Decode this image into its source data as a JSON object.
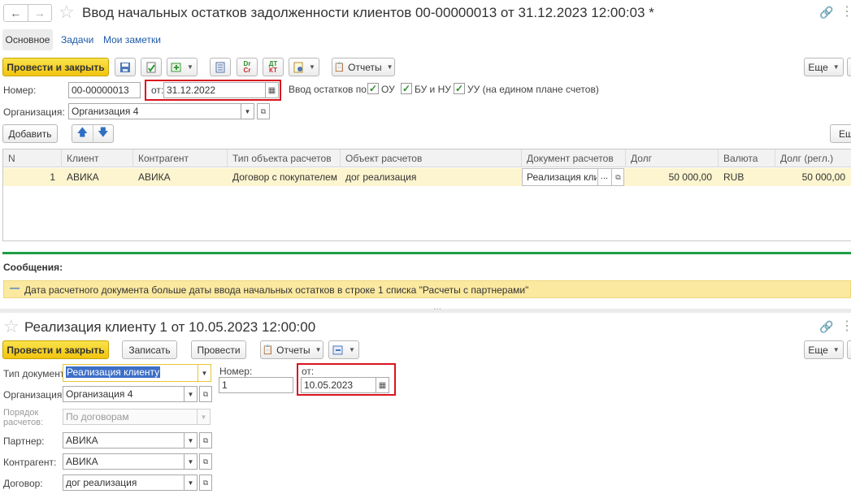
{
  "doc1": {
    "title": "Ввод начальных остатков задолженности клиентов 00-00000013 от 31.12.2023 12:00:03 *",
    "tabs": [
      "Основное",
      "Задачи",
      "Мои заметки"
    ],
    "toolbar": {
      "post_close": "Провести и закрыть",
      "reports": "Отчеты",
      "more": "Еще",
      "help": "?",
      "dt_kt_top": "Dr",
      "dt_kt_bottom": "Cr",
      "dt_top": "ДТ",
      "dt_bottom": "КТ"
    },
    "number_label": "Номер:",
    "number_value": "00-00000013",
    "date_label": "от:",
    "date_value": "31.12.2022",
    "entry_label": "Ввод остатков по:",
    "checks": [
      "ОУ",
      "БУ и НУ",
      "УУ (на едином плане счетов)"
    ],
    "org_label": "Организация:",
    "org_value": "Организация 4",
    "add_button": "Добавить",
    "more_short": "Еш",
    "table": {
      "headers": [
        "N",
        "Клиент",
        "Контрагент",
        "Тип объекта расчетов",
        "Объект расчетов",
        "Документ расчетов",
        "Долг",
        "Валюта",
        "Долг (регл.)"
      ],
      "row": {
        "n": "1",
        "client": "АВИКА",
        "contractor": "АВИКА",
        "type": "Договор с покупателем",
        "object": "дог реализация",
        "document": "Реализация клие",
        "dots": "...",
        "debt": "50 000,00",
        "currency": "RUB",
        "debt_regl": "50 000,00"
      }
    },
    "messages_title": "Сообщения:",
    "message_text": "Дата расчетного документа больше даты ввода начальных остатков в строке 1 списка \"Расчеты с партнерами\""
  },
  "doc2": {
    "title": "Реализация клиенту 1 от 10.05.2023 12:00:00",
    "toolbar": {
      "post_close": "Провести и закрыть",
      "save": "Записать",
      "post": "Провести",
      "reports": "Отчеты",
      "more": "Еще"
    },
    "doc_type_label": "Тип документа:",
    "doc_type_value": "Реализация клиенту",
    "number_label": "Номер:",
    "number_value": "1",
    "date_label": "от:",
    "date_value": "10.05.2023",
    "org_label": "Организация:",
    "org_value": "Организация 4",
    "order_label_1": "Порядок",
    "order_label_2": "расчетов:",
    "order_value": "По договорам",
    "partner_label": "Партнер:",
    "partner_value": "АВИКА",
    "contractor_label": "Контрагент:",
    "contractor_value": "АВИКА",
    "contract_label": "Договор:",
    "contract_value": "дог реализация"
  },
  "colors": {
    "accent_yellow": "#f5d327",
    "highlight_row": "#fdf5cf",
    "message_bg": "#fbe9a0",
    "divider_green": "#1f9e45",
    "red_frame": "#d9141f",
    "link_blue": "#1e5aa8"
  }
}
